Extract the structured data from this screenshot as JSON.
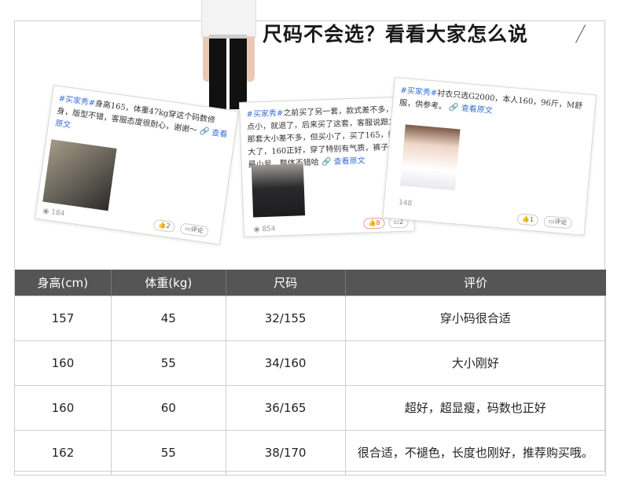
{
  "header": {
    "title": "尺码不会选？看看大家怎么说"
  },
  "reviews": [
    {
      "tag": "#买家秀#",
      "text": "身高165，体重47kg穿这个码数修身，版型不错，客服态度很耐心，谢谢～",
      "link_label": "查看原文",
      "views": "184",
      "likes": "2",
      "comment_label": "评论"
    },
    {
      "tag": "#买家秀#",
      "text": "之前买了另一套，款式差不多，有点小，就退了，后来买了这套，客服说跟之前那套大小差不多，但买小了，买了165，结果大了，160正好，穿了特别有气质，裤子穿了最小号，整体不错哈",
      "link_label": "查看原文",
      "views": "854",
      "likes": "8",
      "comments": "2"
    },
    {
      "tag": "#买家秀#",
      "text": "衬衣只选G2000，本人160，96斤，M舒服，供参考。",
      "link_label": "查看原文",
      "views": "148",
      "likes": "1",
      "comment_label": "评论"
    }
  ],
  "size_table": {
    "headers": [
      "身高(cm)",
      "体重(kg)",
      "尺码",
      "评价"
    ],
    "rows": [
      [
        "157",
        "45",
        "32/155",
        "穿小码很合适"
      ],
      [
        "160",
        "55",
        "34/160",
        "大小刚好"
      ],
      [
        "160",
        "60",
        "36/165",
        "超好，超显瘦，码数也正好"
      ],
      [
        "162",
        "55",
        "38/170",
        "很合适，不褪色，长度也刚好，推荐购买哦。"
      ]
    ]
  }
}
